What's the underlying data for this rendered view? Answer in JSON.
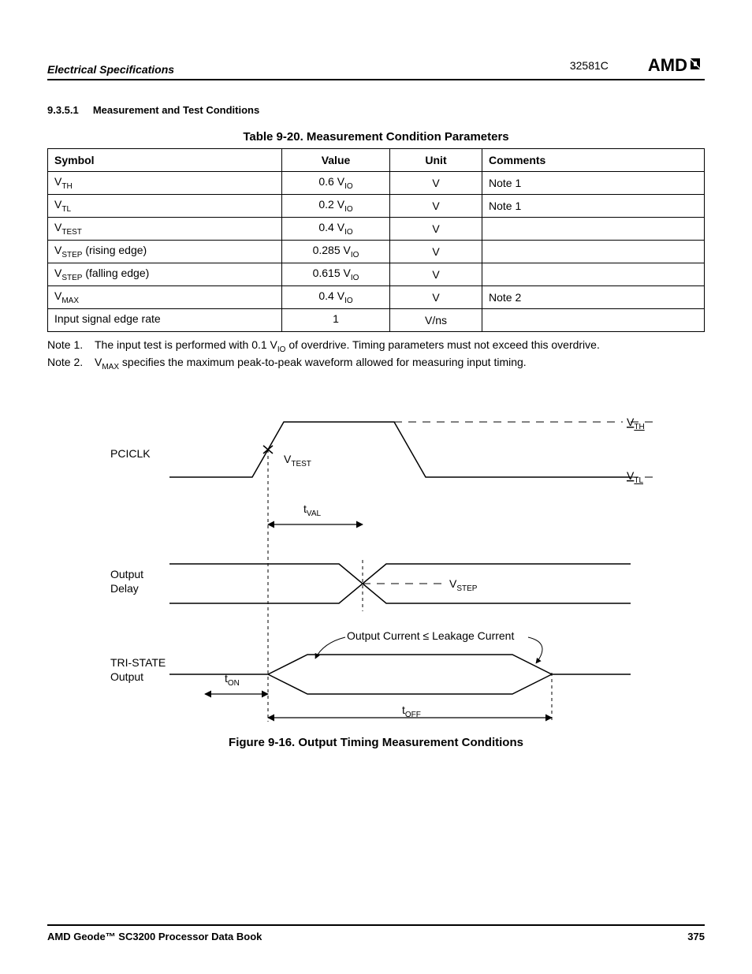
{
  "header": {
    "section": "Electrical Specifications",
    "docnum": "32581C",
    "logo": "AMD"
  },
  "section": {
    "number": "9.3.5.1",
    "title": "Measurement and Test Conditions"
  },
  "table": {
    "caption": "Table 9-20.  Measurement Condition Parameters",
    "headers": {
      "c0": "Symbol",
      "c1": "Value",
      "c2": "Unit",
      "c3": "Comments"
    },
    "rows": [
      {
        "sym_base": "V",
        "sym_sub": "TH",
        "sym_tail": "",
        "val_pre": "0.6 V",
        "val_sub": "IO",
        "unit": "V",
        "comment": "Note 1"
      },
      {
        "sym_base": "V",
        "sym_sub": "TL",
        "sym_tail": "",
        "val_pre": "0.2 V",
        "val_sub": "IO",
        "unit": "V",
        "comment": "Note 1"
      },
      {
        "sym_base": "V",
        "sym_sub": "TEST",
        "sym_tail": "",
        "val_pre": "0.4 V",
        "val_sub": "IO",
        "unit": "V",
        "comment": ""
      },
      {
        "sym_base": "V",
        "sym_sub": "STEP",
        "sym_tail": " (rising edge)",
        "val_pre": "0.285 V",
        "val_sub": "IO",
        "unit": "V",
        "comment": ""
      },
      {
        "sym_base": "V",
        "sym_sub": "STEP",
        "sym_tail": " (falling edge)",
        "val_pre": "0.615 V",
        "val_sub": "IO",
        "unit": "V",
        "comment": ""
      },
      {
        "sym_base": "V",
        "sym_sub": "MAX",
        "sym_tail": "",
        "val_pre": "0.4 V",
        "val_sub": "IO",
        "unit": "V",
        "comment": "Note 2"
      },
      {
        "sym_base": "Input signal edge rate",
        "sym_sub": "",
        "sym_tail": "",
        "val_pre": "1",
        "val_sub": "",
        "unit": "V/ns",
        "comment": ""
      }
    ]
  },
  "notes": {
    "n1_label": "Note 1.",
    "n1_pre": "The input test is performed with 0.1 V",
    "n1_sub": "IO",
    "n1_post": " of overdrive. Timing parameters must not exceed this overdrive.",
    "n2_label": "Note 2.",
    "n2_pre": "V",
    "n2_sub": "MAX",
    "n2_post": " specifies the maximum peak-to-peak waveform allowed for measuring input timing."
  },
  "figure": {
    "caption": "Figure 9-16.  Output Timing Measurement Conditions",
    "labels": {
      "pciclk": "PCICLK",
      "vtest_base": "V",
      "vtest_sub": "TEST",
      "vth_base": "V",
      "vth_sub": "TH",
      "vtl_base": "V",
      "vtl_sub": "TL",
      "tval_base": "t",
      "tval_sub": "VAL",
      "output_delay_l1": "Output",
      "output_delay_l2": "Delay",
      "vstep_base": "V",
      "vstep_sub": "STEP",
      "leak": "Output Current  ≤  Leakage Current",
      "tristate_l1": "TRI-STATE",
      "tristate_l2": "Output",
      "ton_base": "t",
      "ton_sub": "ON",
      "toff_base": "t",
      "toff_sub": "OFF"
    }
  },
  "footer": {
    "book": "AMD Geode™ SC3200 Processor Data Book",
    "page": "375"
  }
}
